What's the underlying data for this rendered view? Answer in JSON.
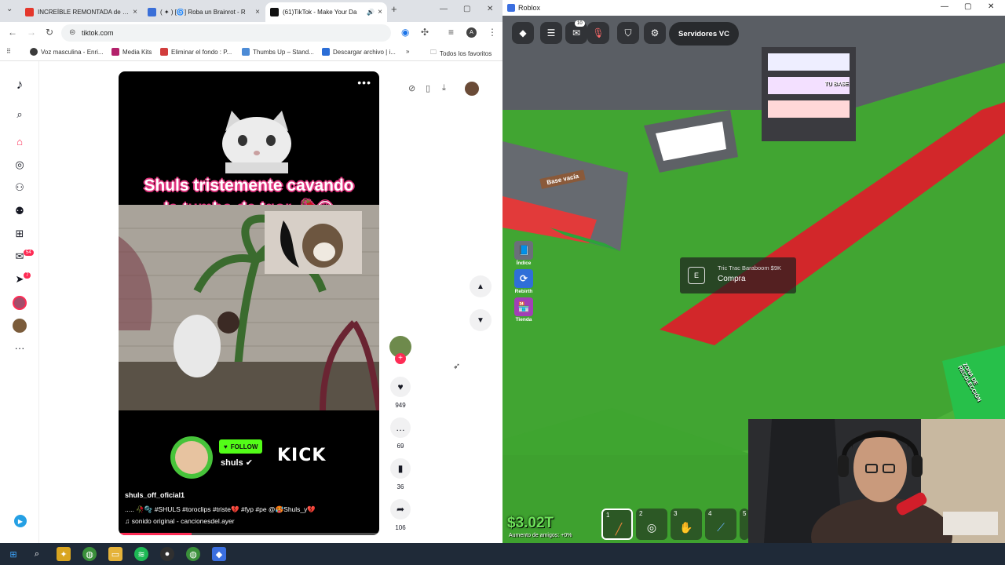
{
  "browser": {
    "tabs": [
      {
        "title": "INCREÍBLE REMONTADA de JUE",
        "fav": "#e4372c"
      },
      {
        "title": "( ✦ ) [🌀] Roba un Brainrot - R",
        "fav": "#3a6fd8"
      },
      {
        "title": "(61)TikTok - Make Your Da",
        "fav": "#111111"
      }
    ],
    "url": "tiktok.com",
    "bookmarks": [
      {
        "label": "Voz masculina - Enri...",
        "fav": "#3b3b3b"
      },
      {
        "label": "Media Kits",
        "fav": "#b3216b"
      },
      {
        "label": "Eliminar el fondo : P...",
        "fav": "#d13d3d"
      },
      {
        "label": "Thumbs Up – Stand...",
        "fav": "#4c8bd6"
      },
      {
        "label": "Descargar archivo | i...",
        "fav": "#2b6dd6"
      }
    ],
    "all_bookmarks": "Todos los favoritos"
  },
  "tiktok": {
    "nav_badges": {
      "messages": "54",
      "activity": "7"
    },
    "video": {
      "caption_line1": "Shuls tristemente cavando",
      "caption_line2": "la tumba de Igor 🥀😔",
      "follow_label": "FOLLOW",
      "streamer_name": "shuls ✔",
      "platform": "KICK",
      "author": "shuls_off_oficial1",
      "description": "..... 🥀🫧 #SHULS #toroclips #triste💔 #fyp #pe @🥵Shuls_y💔",
      "sound": "♫ sonido original - cancionesdel.ayer",
      "progress": 0.28
    },
    "actions": {
      "likes": "949",
      "comments": "69",
      "saves": "36",
      "shares": "106"
    }
  },
  "roblox": {
    "window_title": "Roblox",
    "menu_badge": "10",
    "server_button": "Servidores VC",
    "side_buttons": [
      {
        "label": "Índice",
        "color": "#6b6f7a",
        "icon": "book-icon"
      },
      {
        "label": "Rebirth",
        "color": "#2f6fd8",
        "icon": "refresh-icon"
      },
      {
        "label": "Tienda",
        "color": "#a23fb6",
        "icon": "shop-icon"
      }
    ],
    "prompt": {
      "key": "E",
      "object": "Tric Trac Baraboom $9K",
      "action": "Compra"
    },
    "base_sign": "Base vacía",
    "your_base_sign": "TU BASE",
    "collect_sign": "ZONA DE RECOLECCIÓN",
    "money": "$3.02T",
    "friends_boost": "Aumento de amigos: +0%",
    "hotbar": [
      "1",
      "2",
      "3",
      "4",
      "5"
    ]
  }
}
